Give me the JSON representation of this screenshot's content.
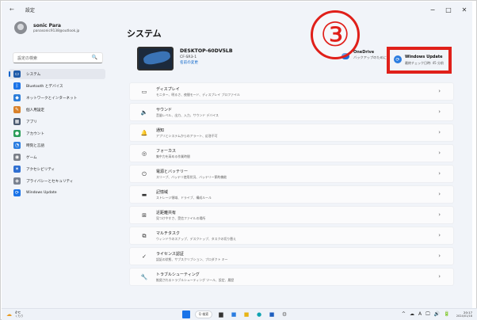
{
  "window": {
    "back_label": "←",
    "app_title": "設定",
    "controls": [
      "−",
      "□",
      "✕"
    ]
  },
  "user": {
    "name": "sonic Para",
    "email": "panasonic9138@outlook.jp"
  },
  "search": {
    "placeholder": "設定の検索",
    "icon": "🔍"
  },
  "sidebar": {
    "items": [
      {
        "label": "システム",
        "icon": "system-icon",
        "color": "#1e5aa8",
        "selected": true
      },
      {
        "label": "Bluetooth とデバイス",
        "icon": "bluetooth-icon",
        "color": "#1a73e8"
      },
      {
        "label": "ネットワークとインターネット",
        "icon": "network-icon",
        "color": "#2d7ed9"
      },
      {
        "label": "個人用設定",
        "icon": "brush-icon",
        "color": "#d9822b"
      },
      {
        "label": "アプリ",
        "icon": "apps-icon",
        "color": "#4a5a70"
      },
      {
        "label": "アカウント",
        "icon": "account-icon",
        "color": "#2e9e5b"
      },
      {
        "label": "時刻と言語",
        "icon": "clock-icon",
        "color": "#2b7de0"
      },
      {
        "label": "ゲーム",
        "icon": "game-icon",
        "color": "#7a7f88"
      },
      {
        "label": "アクセシビリティ",
        "icon": "accessibility-icon",
        "color": "#2f6fd1"
      },
      {
        "label": "プライバシーとセキュリティ",
        "icon": "shield-icon",
        "color": "#7a8290"
      },
      {
        "label": "Windows Update",
        "icon": "update-icon",
        "color": "#1a73e8"
      }
    ]
  },
  "main": {
    "title": "システム",
    "device": {
      "name": "DESKTOP-60DV5LB",
      "model": "CF-SR3-1",
      "rename": "名前の変更"
    },
    "onedrive": {
      "title": "OneDrive",
      "subtitle": "バックアップのためにサインイン"
    },
    "callout_number": "③",
    "windows_update": {
      "title": "Windows Update",
      "subtitle": "最終チェック日時: 45 分前"
    },
    "settings": [
      {
        "title": "ディスプレイ",
        "subtitle": "モニター、明るさ、夜間モード、ディスプレイ プロファイル",
        "icon": "display-icon",
        "glyph": "▭"
      },
      {
        "title": "サウンド",
        "subtitle": "音量レベル、出力、入力、サウンド デバイス",
        "icon": "sound-icon",
        "glyph": "🔈"
      },
      {
        "title": "通知",
        "subtitle": "アプリとシステムからのアラート、応答不可",
        "icon": "bell-icon",
        "glyph": "🔔"
      },
      {
        "title": "フォーカス",
        "subtitle": "集中力を高める作業時間",
        "icon": "focus-icon",
        "glyph": "◎"
      },
      {
        "title": "電源とバッテリー",
        "subtitle": "スリープ、バッテリ使用状況、バッテリー節約機能",
        "icon": "power-icon",
        "glyph": "⏻"
      },
      {
        "title": "記憶域",
        "subtitle": "ストレージ領域、ドライブ、構成ルール",
        "icon": "storage-icon",
        "glyph": "▬"
      },
      {
        "title": "近距離共有",
        "subtitle": "見つけやすさ、受信ファイルの場所",
        "icon": "share-icon",
        "glyph": "⊞"
      },
      {
        "title": "マルチタスク",
        "subtitle": "ウィンドウのスナップ、デスクトップ、タスクの切り替え",
        "icon": "multitask-icon",
        "glyph": "⧉"
      },
      {
        "title": "ライセンス認証",
        "subtitle": "認証の状態、サブスクリプション、プロダクト キー",
        "icon": "activation-icon",
        "glyph": "✓"
      },
      {
        "title": "トラブルシューティング",
        "subtitle": "推奨されるトラブルシューティング ツール、設定、履歴",
        "icon": "wrench-icon",
        "glyph": "🔧"
      }
    ],
    "chevron": "›"
  },
  "taskbar": {
    "weather_temp": "4℃",
    "weather_text": "くもり",
    "search_label": "Q 検索",
    "tray_icons": [
      "^",
      "☁",
      "A",
      "🖵",
      "🔊",
      "🔋"
    ],
    "time": "20:17",
    "date": "2024/01/18"
  }
}
